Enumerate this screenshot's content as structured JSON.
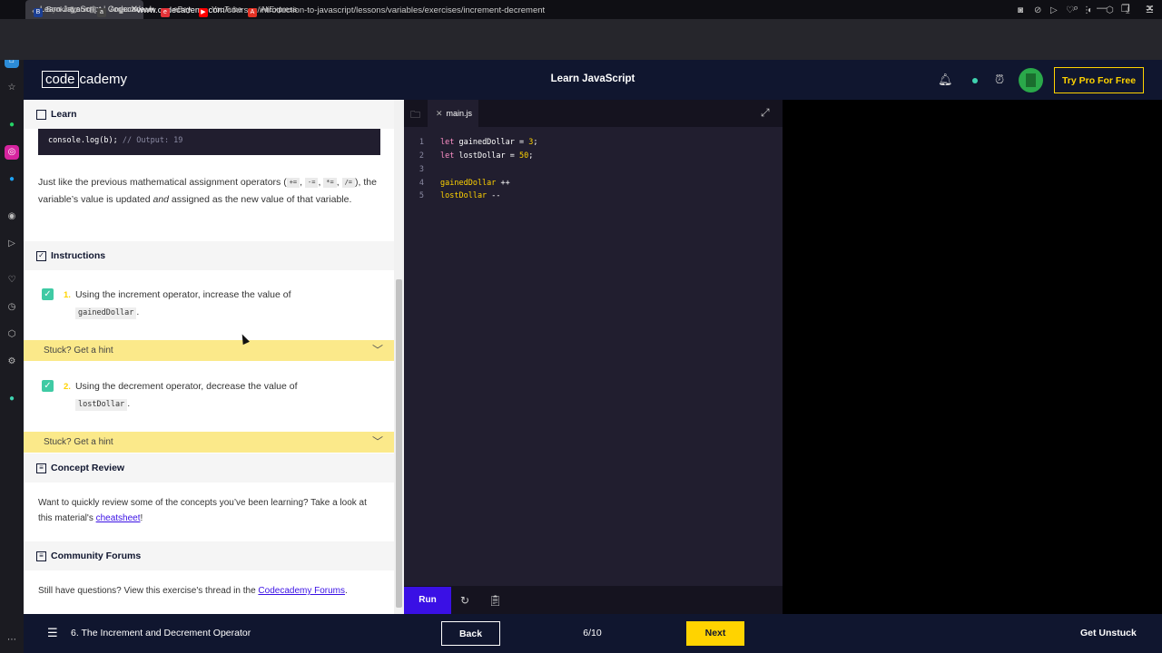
{
  "browser": {
    "tab_title": "Learn JavaScript | Codecademy",
    "url_host": "www.codecademy.com",
    "url_path": "/courses/introduction-to-javascript/lessons/variables/exercises/increment-decrement",
    "bookmarks": [
      {
        "label": "Booking.com",
        "color": "#1c3f94",
        "glyph": "B"
      },
      {
        "label": "Amazon.com",
        "color": "#444444",
        "glyph": "a"
      },
      {
        "label": "eBay",
        "color": "#e53238",
        "glyph": "e"
      },
      {
        "label": "YouTube",
        "color": "#ff0000",
        "glyph": "▶"
      },
      {
        "label": "AliExpress",
        "color": "#e43225",
        "glyph": "A"
      }
    ]
  },
  "header": {
    "logo_box": "code",
    "logo_rest": "cademy",
    "title": "Learn JavaScript",
    "try_pro": "Try Pro For Free"
  },
  "lesson": {
    "learn_heading": "Learn",
    "code_snippet": "console.log(b);",
    "code_comment": "// Output: 19",
    "para_before": "Just like the previous mathematical assignment operators (",
    "ops": [
      "+=",
      "-=",
      "*=",
      "/="
    ],
    "para_after": "), the variable’s value is updated ",
    "para_em": "and",
    "para_end": " assigned as the new value of that variable.",
    "instructions_heading": "Instructions",
    "tasks": [
      {
        "num": "1.",
        "text": "Using the increment operator, increase the value of",
        "code": "gainedDollar",
        "tail": "."
      },
      {
        "num": "2.",
        "text": "Using the decrement operator, decrease the value of",
        "code": "lostDollar",
        "tail": "."
      }
    ],
    "hint_label": "Stuck? Get a hint",
    "concept_heading": "Concept Review",
    "concept_text": "Want to quickly review some of the concepts you’ve been learning? Take a look at this material's ",
    "concept_link": "cheatsheet",
    "concept_tail": "!",
    "forums_heading": "Community Forums",
    "forums_text": "Still have questions? View this exercise's thread in the ",
    "forums_link": "Codecademy Forums",
    "forums_tail": "."
  },
  "editor": {
    "file_tab": "main.js",
    "lines": [
      {
        "n": "1",
        "kw": "let",
        "name": " gainedDollar = ",
        "val": "3",
        "end": ";"
      },
      {
        "n": "2",
        "kw": "let",
        "name": " lostDollar = ",
        "val": "50",
        "end": ";"
      },
      {
        "n": "3",
        "kw": "",
        "name": "",
        "val": "",
        "end": ""
      },
      {
        "n": "4",
        "kw": "",
        "name": "",
        "val": "gainedDollar",
        "end": " ++"
      },
      {
        "n": "5",
        "kw": "",
        "name": "",
        "val": "lostDollar",
        "end": " --"
      }
    ],
    "run_label": "Run"
  },
  "footer": {
    "lesson_name": "6. The Increment and Decrement Operator",
    "back_label": "Back",
    "progress": "6/10",
    "next_label": "Next",
    "unstuck_label": "Get Unstuck"
  }
}
